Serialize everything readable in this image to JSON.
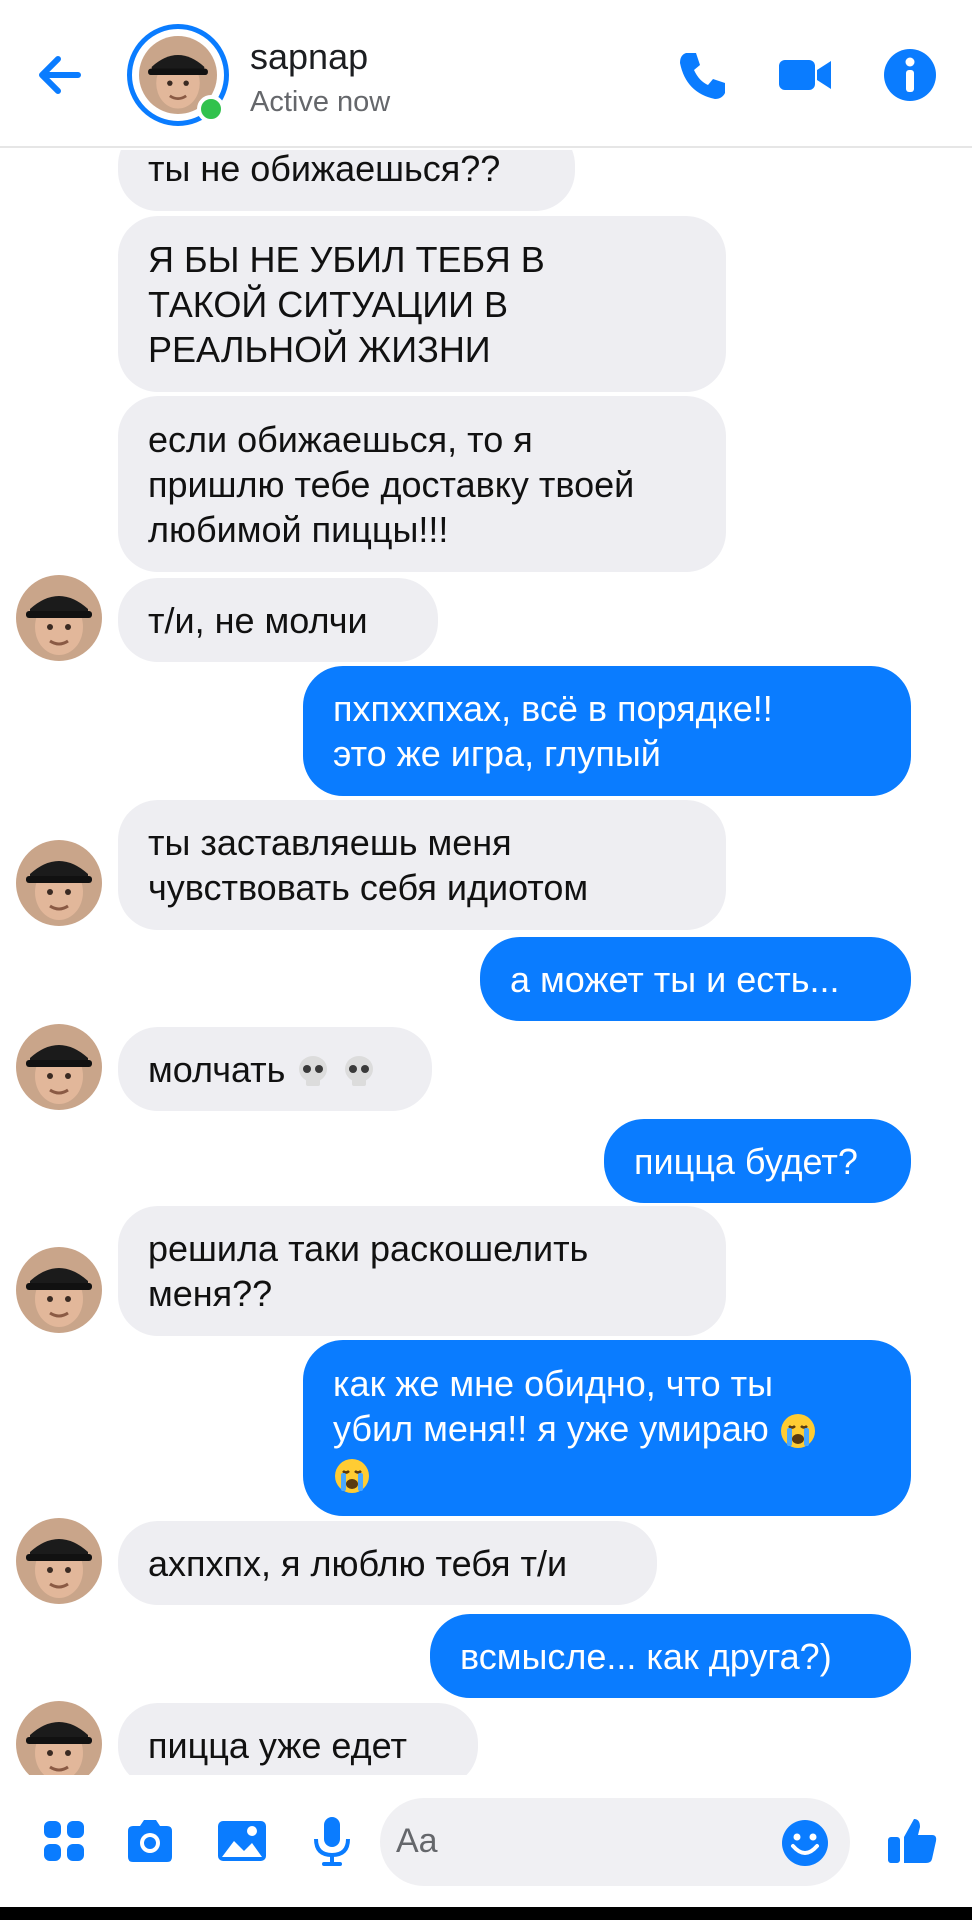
{
  "header": {
    "contact_name": "sapnap",
    "status": "Active now"
  },
  "messages": [
    {
      "dir": "in",
      "lines": [
        "ты не обижаешься??"
      ]
    },
    {
      "dir": "in",
      "lines": [
        "Я БЫ НЕ УБИЛ ТЕБЯ В",
        "ТАКОЙ СИТУАЦИИ В",
        "РЕАЛЬНОЙ ЖИЗНИ"
      ]
    },
    {
      "dir": "in",
      "lines": [
        "если обижаешься, то я",
        "пришлю тебе доставку твоей",
        "любимой пиццы!!!"
      ]
    },
    {
      "dir": "in",
      "lines": [
        "т/и, не молчи"
      ]
    },
    {
      "dir": "out",
      "lines": [
        "пхпххпхах, всё в порядке!!",
        "это же игра, глупый"
      ]
    },
    {
      "dir": "in",
      "lines": [
        "ты заставляешь меня",
        "чувствовать себя идиотом"
      ]
    },
    {
      "dir": "out",
      "lines": [
        "а может ты и есть..."
      ]
    },
    {
      "dir": "in",
      "lines": [
        "молчать"
      ],
      "emoji": "skull-emoji-x2"
    },
    {
      "dir": "out",
      "lines": [
        "пицца будет?"
      ]
    },
    {
      "dir": "in",
      "lines": [
        "решила таки раскошелить",
        "меня??"
      ]
    },
    {
      "dir": "out",
      "lines": [
        "как же мне обидно, что ты",
        "убил меня!! я уже умираю"
      ],
      "emoji": "crying-emoji-x2"
    },
    {
      "dir": "in",
      "lines": [
        "ахпхпх, я люблю тебя т/и"
      ]
    },
    {
      "dir": "out",
      "lines": [
        "всмысле... как друга?)"
      ]
    },
    {
      "dir": "in",
      "lines": [
        "пицца уже едет"
      ]
    }
  ],
  "composer": {
    "placeholder": "Aa",
    "icons": [
      "apps-icon",
      "camera-icon",
      "gallery-icon",
      "microphone-icon",
      "smiley-icon",
      "thumbs-up-icon"
    ]
  },
  "colors": {
    "accent": "#0a7cff",
    "incoming_bubble": "#eeeef2",
    "online": "#31c24d"
  }
}
